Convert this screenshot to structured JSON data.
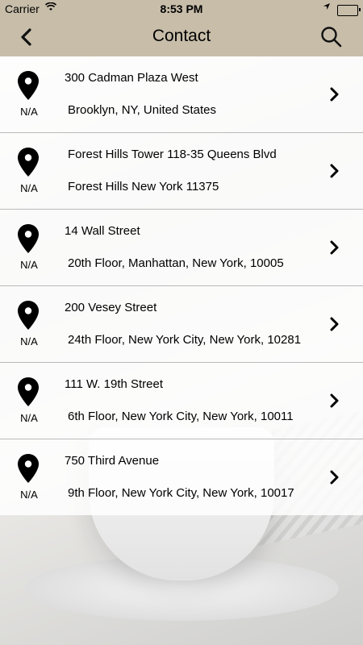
{
  "status_bar": {
    "carrier": "Carrier",
    "time": "8:53 PM",
    "battery_level": 1.0
  },
  "header": {
    "title": "Contact",
    "back_icon": "chevron-left-icon",
    "search_icon": "search-icon"
  },
  "locations": [
    {
      "line1": "300 Cadman Plaza West",
      "line2": "Brooklyn, NY, United States",
      "distance": "N/A"
    },
    {
      "line1": "Forest Hills Tower 118-35 Queens Blvd",
      "line2": "Forest Hills New York 11375",
      "distance": "N/A"
    },
    {
      "line1": "14 Wall Street",
      "line2": "20th Floor, Manhattan, New York, 10005",
      "distance": "N/A"
    },
    {
      "line1": "200 Vesey Street",
      "line2": "24th Floor, New York City, New York, 10281",
      "distance": "N/A"
    },
    {
      "line1": "111 W. 19th Street",
      "line2": "6th Floor, New York City, New York, 10011",
      "distance": "N/A"
    },
    {
      "line1": "750 Third Avenue",
      "line2": "9th Floor, New York City, New York, 10017",
      "distance": "N/A"
    }
  ],
  "colors": {
    "header_bg": "#c7bda9",
    "row_bg": "rgba(255,255,255,0.84)",
    "divider": "#b9b9b9"
  }
}
